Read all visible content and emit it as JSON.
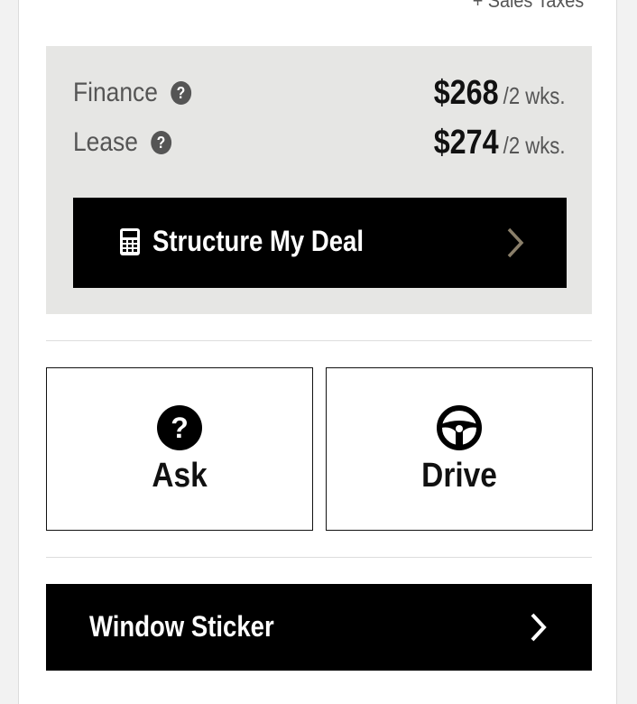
{
  "header": {
    "tax_note": "+ Sales Taxes"
  },
  "payments": {
    "finance": {
      "label": "Finance",
      "help_icon": "question-circle-icon",
      "amount": "$268",
      "period": "/2 wks."
    },
    "lease": {
      "label": "Lease",
      "help_icon": "question-circle-icon",
      "amount": "$274",
      "period": "/2 wks."
    }
  },
  "deal_button": {
    "label": "Structure My Deal",
    "icon": "calculator-icon",
    "chevron": "chevron-right-icon",
    "chevron_color": "#8a7f6a"
  },
  "actions": [
    {
      "label": "Ask",
      "icon": "question-circle-icon"
    },
    {
      "label": "Drive",
      "icon": "steering-wheel-icon"
    }
  ],
  "sticker_button": {
    "label": "Window Sticker",
    "chevron": "chevron-right-icon"
  },
  "colors": {
    "panel_bg": "#e6e6e4",
    "button_bg": "#000000",
    "text_muted": "#555555"
  }
}
